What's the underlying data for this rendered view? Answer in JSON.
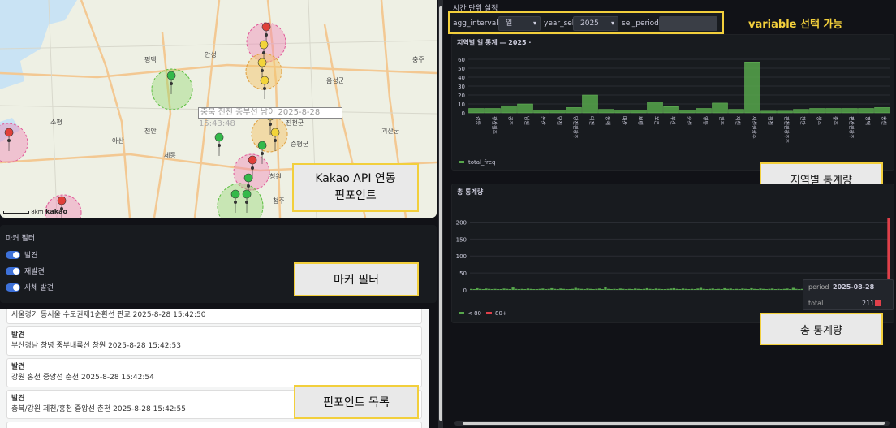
{
  "map": {
    "tooltip_line1": "충북 진천 중부선 남이 2025-8-28",
    "tooltip_line2": "15:43:48",
    "scale": "8km",
    "attribution": "kakao",
    "places": [
      "평택",
      "안성",
      "충주",
      "아산",
      "천안",
      "세종",
      "청주",
      "괴산군",
      "음성군",
      "진천군",
      "증평군",
      "소평",
      "청원"
    ],
    "colors": {
      "red": "#e0403a",
      "yellow": "#f2d43a",
      "green": "#34b94a",
      "pink_zone": "#f08ab8",
      "yellow_zone": "#f4c46a",
      "green_zone": "#8fd86b"
    }
  },
  "callouts": {
    "kakao": "Kakao API 연동\n핀포인트",
    "marker_filter": "마커 필터",
    "pinpoint_list": "핀포인트 목록",
    "variable": "variable  선택 가능",
    "regional": "지역별 통계량",
    "total": "총 통계량"
  },
  "filter": {
    "title": "마커 필터",
    "toggles": [
      {
        "label": "발견",
        "on": true
      },
      {
        "label": "재발견",
        "on": true
      },
      {
        "label": "사체 발견",
        "on": true
      }
    ]
  },
  "list": {
    "items": [
      {
        "heading": "",
        "detail": "서울경기 동서울 수도권제1순환선 판교 2025-8-28 15:42:50"
      },
      {
        "heading": "발견",
        "detail": "부산경남 창녕 중부내륙선 창원 2025-8-28 15:42:53"
      },
      {
        "heading": "발견",
        "detail": "강원 홍천 중앙선 춘천 2025-8-28 15:42:54"
      },
      {
        "heading": "발견",
        "detail": "충북/강원 제천/홍천 중앙선 춘천 2025-8-28 15:42:55"
      }
    ]
  },
  "controls": {
    "section_title": "시간 단위 설정",
    "agg_interval_label": "agg_interval",
    "agg_interval_value": "일",
    "year_sel_label": "year_sel",
    "year_sel_value": "2025",
    "sel_period_label": "sel_period"
  },
  "regional_panel": {
    "title": "지역별 일 통계 — 2025 ·",
    "legend": "total_freq",
    "legend_color": "#56a64b"
  },
  "total_panel": {
    "title": "총 통계량",
    "legend": [
      {
        "label": "< 80",
        "color": "#56a64b"
      },
      {
        "label": "80+",
        "color": "#e0404a"
      }
    ],
    "tooltip": {
      "period_label": "period",
      "period_value": "2025-08-28",
      "total_label": "total",
      "total_value": "211"
    }
  },
  "chart_data": [
    {
      "type": "bar",
      "title": "지역별 일 통계 — 2025 ·",
      "categories": [
        "강릉",
        "광산원주",
        "공주",
        "남원",
        "논산",
        "당진",
        "당진원광주",
        "대전",
        "동해",
        "마산",
        "보령",
        "보은",
        "부산",
        "순천",
        "영동",
        "원주",
        "제천",
        "제천원광주",
        "진천",
        "진천원광주주",
        "천안",
        "청주",
        "충주",
        "편산원광주",
        "평택",
        "홍천"
      ],
      "series": [
        {
          "name": "total_freq",
          "values": [
            5,
            5,
            8,
            10,
            3,
            3,
            6,
            20,
            4,
            3,
            3,
            12,
            7,
            3,
            5,
            11,
            4,
            57,
            2,
            2,
            4,
            5,
            5,
            5,
            5,
            6
          ]
        }
      ],
      "ylim": [
        0,
        60
      ],
      "yticks": [
        0,
        10,
        20,
        30,
        40,
        50,
        60
      ]
    },
    {
      "type": "bar",
      "title": "총 통계량",
      "yticks": [
        0,
        50,
        100,
        150,
        200
      ],
      "ylim": [
        0,
        225
      ],
      "series": [
        {
          "name": "< 80",
          "values": [
            3,
            2,
            5,
            3,
            2,
            4,
            3,
            2,
            3,
            2,
            2,
            4,
            3,
            2,
            7,
            3,
            2,
            3,
            2,
            4,
            3,
            2,
            2,
            3,
            4,
            2,
            3,
            5,
            3,
            2,
            4,
            3,
            2,
            2,
            3,
            6,
            4,
            3,
            2,
            4,
            3,
            2,
            3,
            4,
            2,
            8,
            3,
            2,
            3,
            2,
            4,
            3,
            2,
            3,
            2,
            4,
            3,
            2,
            3,
            5,
            3,
            2,
            4,
            3,
            2,
            2,
            3,
            4,
            5,
            3,
            2,
            4,
            3,
            2,
            3,
            2,
            4,
            6,
            3,
            2,
            3,
            4,
            2,
            3,
            2,
            5,
            3,
            4,
            2,
            3,
            2,
            4,
            3,
            2,
            5,
            3,
            2,
            4,
            3,
            2,
            3,
            4,
            2,
            3,
            2,
            3,
            4,
            2,
            6,
            3,
            2,
            3,
            2,
            4,
            3,
            2,
            3,
            4,
            2,
            3,
            2,
            3,
            5,
            3,
            2,
            4,
            3,
            2,
            3,
            6,
            3,
            2,
            4,
            3,
            2,
            3,
            2,
            4,
            3,
            5
          ]
        },
        {
          "name": "80+",
          "values": [
            211
          ]
        }
      ]
    }
  ]
}
